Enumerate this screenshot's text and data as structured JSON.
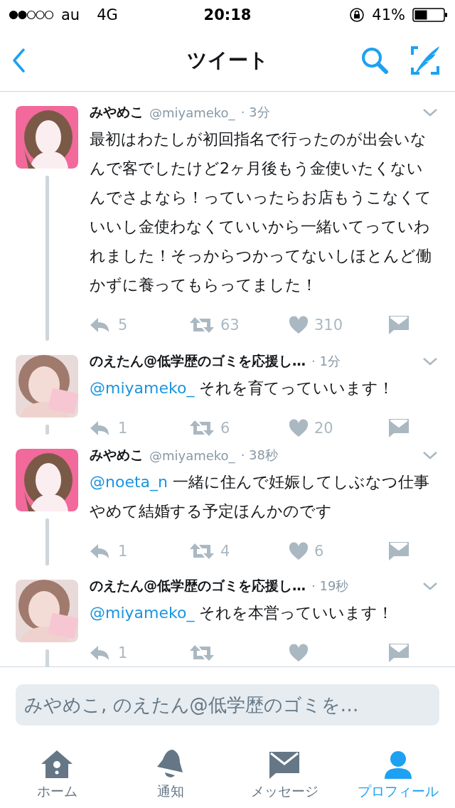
{
  "status_bar": {
    "carrier": "au",
    "network": "4G",
    "time": "20:18",
    "battery": "41%"
  },
  "nav": {
    "title": "ツイート"
  },
  "tweets": [
    {
      "name": "みやめこ",
      "handle": "@miyameko_",
      "time": "· 3分",
      "body": "最初はわたしが初回指名で行ったのが出会いなんで客でしたけど2ヶ月後もう金使いたくないんでさよなら！っていったらお店もうこなくていいし金使わなくていいから一緒いてっていわれました！そっからつかってないしほとんど働かずに養ってもらってました！",
      "actions": [
        {
          "kind": "reply",
          "count": "5"
        },
        {
          "kind": "retweet",
          "count": "63"
        },
        {
          "kind": "like",
          "count": "310"
        },
        {
          "kind": "dm"
        }
      ]
    },
    {
      "name": "のえたん@低学歴のゴミを応援し…",
      "time": "· 1分",
      "mention": "@miyameko_",
      "body": "それを育てっていいます！",
      "actions": [
        {
          "kind": "reply",
          "count": "1"
        },
        {
          "kind": "retweet",
          "count": "6"
        },
        {
          "kind": "like",
          "count": "20"
        },
        {
          "kind": "dm"
        }
      ]
    },
    {
      "name": "みやめこ",
      "handle": "@miyameko_",
      "time": "· 38秒",
      "mention": "@noeta_n",
      "body": "一緒に住んで妊娠してしぶなつ仕事やめて結婚する予定ほんかのです",
      "actions": [
        {
          "kind": "reply",
          "count": "1"
        },
        {
          "kind": "retweet",
          "count": "4"
        },
        {
          "kind": "like",
          "count": "6"
        },
        {
          "kind": "dm"
        }
      ]
    },
    {
      "name": "のえたん@低学歴のゴミを応援し…",
      "time": "· 19秒",
      "mention": "@miyameko_",
      "body": "それを本営っていいます！",
      "actions": [
        {
          "kind": "reply",
          "count": "1"
        },
        {
          "kind": "retweet"
        },
        {
          "kind": "like"
        },
        {
          "kind": "dm"
        }
      ]
    }
  ],
  "reply_box": {
    "placeholder": "みやめこ, のえたん@低学歴のゴミを…"
  },
  "tabs": [
    {
      "kind": "home",
      "label": "ホーム",
      "selected": false
    },
    {
      "kind": "bell",
      "label": "通知",
      "selected": false
    },
    {
      "kind": "mail",
      "label": "メッセージ",
      "selected": false
    },
    {
      "kind": "person",
      "label": "プロフィール",
      "selected": true
    }
  ]
}
